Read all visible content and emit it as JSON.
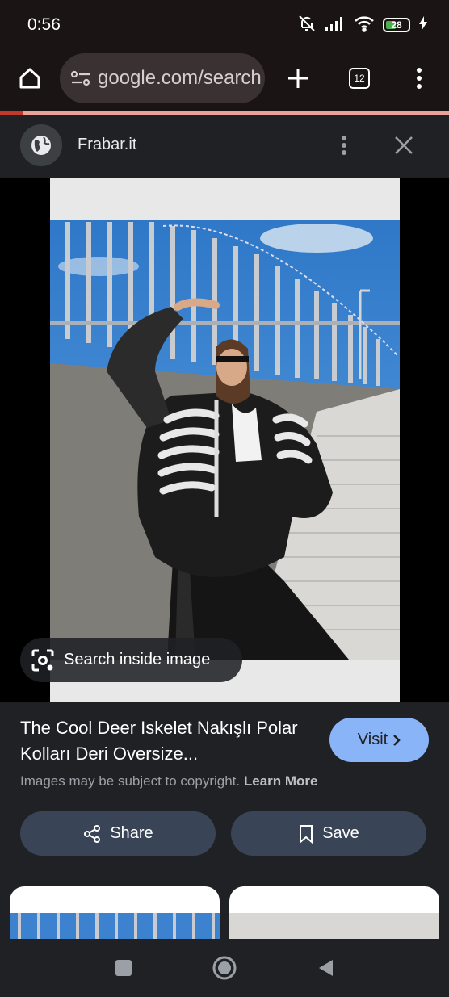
{
  "status_bar": {
    "time": "0:56",
    "battery": "28",
    "icons": [
      "bell-off-icon",
      "signal-icon",
      "wifi-icon",
      "battery-icon",
      "charging-icon"
    ]
  },
  "browser": {
    "url": "google.com/search",
    "tab_count": "12",
    "icons": [
      "home-icon",
      "site-settings-icon",
      "new-tab-icon",
      "tab-switcher-icon",
      "more-menu-icon"
    ]
  },
  "source": {
    "site_name": "Frabar.it"
  },
  "image": {
    "lens_label": "Search inside image",
    "description_icons": [
      "lens-icon"
    ]
  },
  "result": {
    "title": "The Cool Deer Iskelet Nakışlı Polar Kolları Deri Oversize...",
    "visit_label": "Visit",
    "copyright": "Images may be subject to copyright.",
    "learn_more": "Learn More",
    "share_label": "Share",
    "save_label": "Save"
  },
  "colors": {
    "accent": "#8ab4f8",
    "action_button": "#394457",
    "progress": "#c0392b"
  }
}
